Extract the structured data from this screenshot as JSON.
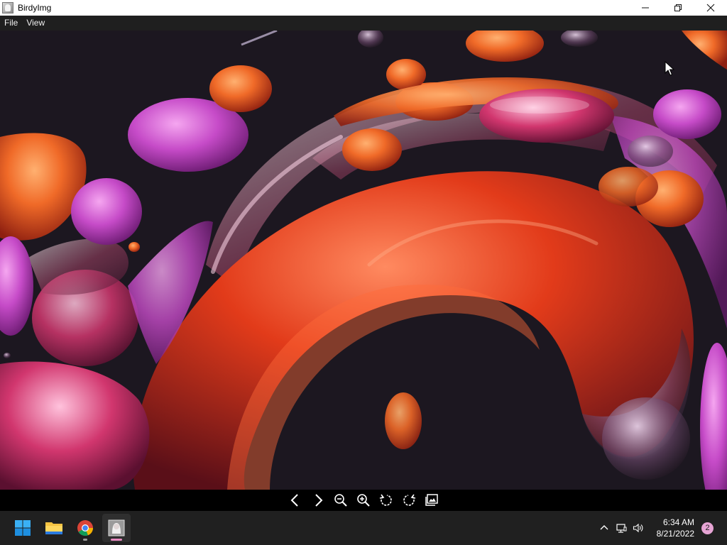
{
  "window": {
    "title": "BirdyImg",
    "icon": "app-icon",
    "controls": [
      "minimize-icon",
      "maximize-icon",
      "close-icon"
    ]
  },
  "menu": {
    "items": [
      {
        "label": "File"
      },
      {
        "label": "View"
      }
    ]
  },
  "viewer_toolbar": {
    "buttons": [
      "previous-icon",
      "next-icon",
      "zoom-out-icon",
      "zoom-in-icon",
      "rotate-left-icon",
      "rotate-right-icon",
      "gallery-icon"
    ]
  },
  "taskbar": {
    "apps": [
      "windows-start-icon",
      "file-explorer-icon",
      "chrome-icon",
      "birdyimg-icon"
    ],
    "active_app": "birdyimg-icon",
    "clock": {
      "time": "6:34 AM",
      "date": "8/21/2022"
    },
    "notification_count": "2"
  },
  "colors": {
    "menu_bg": "#1f1f1f",
    "taskbar_bg": "#202020",
    "image_bg": "#1c1720",
    "accent_orange": "#e8561e",
    "accent_magenta": "#c23aa0",
    "badge": "#e6a4d4"
  }
}
